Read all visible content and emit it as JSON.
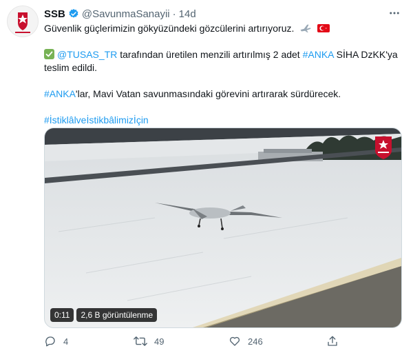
{
  "author": {
    "name": "SSB",
    "handle": "@SavunmaSanayii",
    "separator": "·",
    "time": "14d"
  },
  "body": {
    "line1": "Güvenlik güçlerimizin gökyüzündeki gözcülerini artırıyoruz.",
    "line2_mention": "@TUSAS_TR",
    "line2_text": " tarafından üretilen menzili artırılmış 2 adet ",
    "line2_hashtag": "#ANKA",
    "line2_tail": " SİHA DzKK'ya",
    "line3": "teslim edildi.",
    "line4_hashtag": "#ANKA",
    "line4_text": "'lar, Mavi Vatan savunmasındaki görevini artırarak sürdürecek.",
    "line5_hashtag": "#İstiklâlveİstikbâlimizİçin"
  },
  "media": {
    "duration": "0:11",
    "views": "2,6 B görüntülenme"
  },
  "actions": {
    "replies": "4",
    "retweets": "49",
    "likes": "246"
  },
  "icons": {
    "verified": "verified-badge-icon",
    "more": "more-icon",
    "reply": "reply-icon",
    "retweet": "retweet-icon",
    "like": "heart-icon",
    "share": "share-icon"
  },
  "colors": {
    "link": "#1d9bf0",
    "muted": "#536471",
    "brand_red": "#c8102e"
  }
}
